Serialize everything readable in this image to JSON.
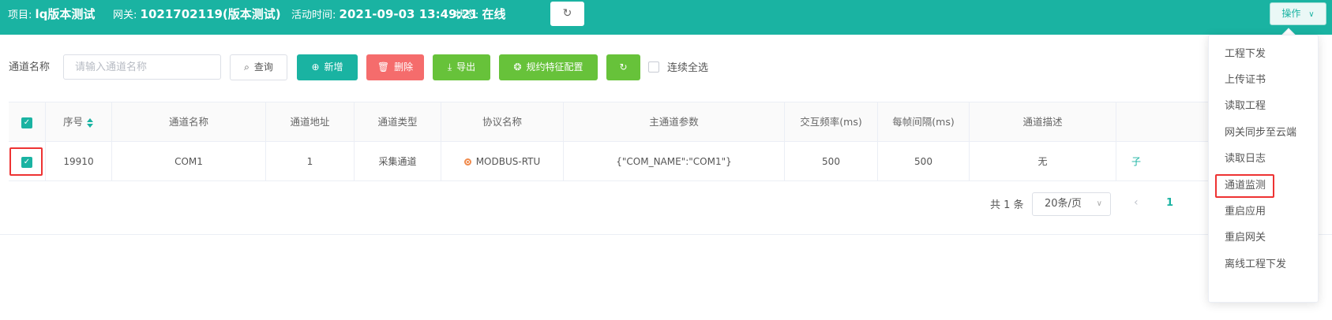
{
  "header": {
    "project_label": "项目:",
    "project_value": "lq版本测试",
    "gateway_label": "网关:",
    "gateway_value": "1021702119(版本测试)",
    "active_label": "活动时间:",
    "active_value": "2021-09-03 13:49:21",
    "status_label": "状态:",
    "status_value": "在线",
    "refresh_icon": "refresh-icon",
    "operation_label": "操作",
    "operation_icon": "chevron-down-icon"
  },
  "toolbar": {
    "search_label": "通道名称",
    "search_placeholder": "请输入通道名称",
    "search_value": "",
    "query_label": "查询",
    "add_label": "新增",
    "delete_label": "删除",
    "export_label": "导出",
    "config_label": "规约特征配置",
    "select_all_label": "连续全选"
  },
  "table": {
    "columns": [
      "序号",
      "通道名称",
      "通道地址",
      "通道类型",
      "协议名称",
      "主通道参数",
      "交互频率(ms)",
      "每帧间隔(ms)",
      "通道描述"
    ],
    "rows": [
      {
        "seq": "19910",
        "name": "COM1",
        "address": "1",
        "type": "采集通道",
        "protocol": "MODBUS-RTU",
        "params": "{\"COM_NAME\":\"COM1\"}",
        "freq": "500",
        "interval": "500",
        "desc": "无",
        "op_fragment": "子",
        "checked": true
      }
    ]
  },
  "pagination": {
    "total_text": "共 1 条",
    "page_size": "20条/页",
    "current_page": "1"
  },
  "menu": {
    "items": [
      "工程下发",
      "上传证书",
      "读取工程",
      "网关同步至云端",
      "读取日志",
      "通道监测",
      "重启应用",
      "重启网关",
      "离线工程下发"
    ],
    "highlighted": "通道监测"
  },
  "colors": {
    "primary": "#1ab3a2",
    "danger": "#f56c6c",
    "success": "#67c23a",
    "highlight_box": "#ee3333"
  }
}
